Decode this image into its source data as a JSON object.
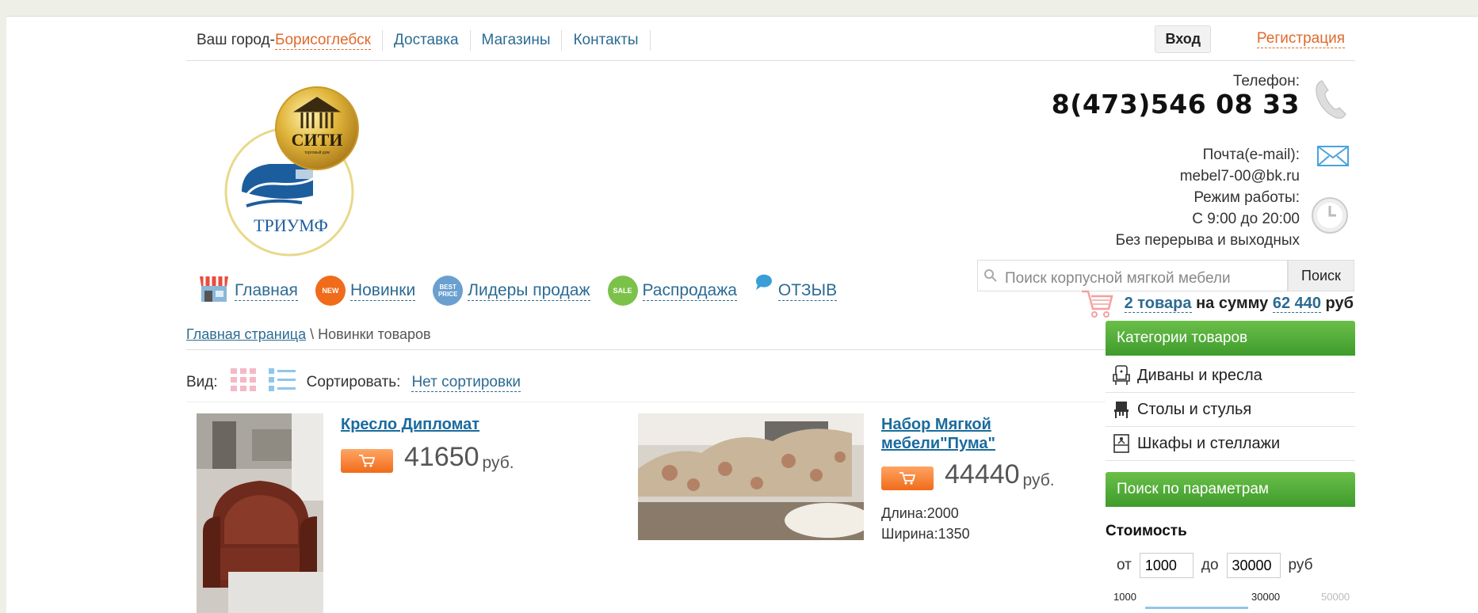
{
  "top_nav": {
    "city_prefix": "Ваш город-",
    "city": "Борисоглебск",
    "links": [
      "Доставка",
      "Магазины",
      "Контакты"
    ],
    "login": "Вход",
    "register": "Регистрация"
  },
  "logo": {
    "top_text": "СИТИ",
    "sub_text": "торговый дом",
    "bottom_text": "ТРИУМФ"
  },
  "contacts": {
    "phone_label": "Телефон:",
    "phone": "8(473)546 08 33",
    "email_label": "Почта(e-mail):",
    "email": "mebel7-00@bk.ru",
    "hours_label": "Режим работы:",
    "hours": "С 9:00 до 20:00",
    "hours_note": "Без перерыва и выходных"
  },
  "main_menu": [
    {
      "label": "Главная",
      "icon": "shop-icon"
    },
    {
      "label": "Новинки",
      "icon": "new-badge-icon",
      "badge": "NEW",
      "color": "#f06b1a"
    },
    {
      "label": "Лидеры продаж",
      "icon": "best-price-badge-icon",
      "badge": "BEST PRICE",
      "color": "#6a9fd0"
    },
    {
      "label": "Распродажа",
      "icon": "sale-badge-icon",
      "badge": "SALE",
      "color": "#7cc24a"
    },
    {
      "label": "ОТЗЫВ",
      "icon": "speech-bubble-icon"
    }
  ],
  "search": {
    "placeholder": "Поиск корпусной мягкой мебели",
    "button": "Поиск"
  },
  "cart": {
    "count_text": "2 товара",
    "middle_text": " на сумму ",
    "sum": "62 440",
    "currency": " руб"
  },
  "breadcrumb": {
    "home": "Главная страница",
    "separator": " \\ ",
    "current": "Новинки товаров"
  },
  "toolbar": {
    "view_label": "Вид:",
    "sort_label": "Сортировать:",
    "sort_value": "Нет сортировки"
  },
  "products": [
    {
      "name": "Кресло Дипломат",
      "price": "41650",
      "unit": "руб."
    },
    {
      "name_line1": "Набор Мягкой",
      "name_line2": "мебели\"Пума\"",
      "price": "44440",
      "unit": "руб.",
      "length": "Длина:2000",
      "width": "Ширина:1350"
    }
  ],
  "sidebar": {
    "categories_title": "Категории товаров",
    "categories": [
      {
        "label": "Диваны и кресла",
        "icon": "armchair-icon"
      },
      {
        "label": "Столы и стулья",
        "icon": "chair-icon"
      },
      {
        "label": "Шкафы и стеллажи",
        "icon": "wardrobe-icon"
      }
    ],
    "params_title": "Поиск по параметрам",
    "cost_label": "Стоимость",
    "from_label": "от",
    "from_value": "1000",
    "to_label": "до",
    "to_value": "30000",
    "currency": "руб",
    "scale_min": "1000",
    "scale_mid": "30000",
    "scale_max": "50000"
  },
  "colors": {
    "link": "#2c6b93",
    "accent_orange": "#e06a2c",
    "sidebar_green": "#4eaa36"
  }
}
